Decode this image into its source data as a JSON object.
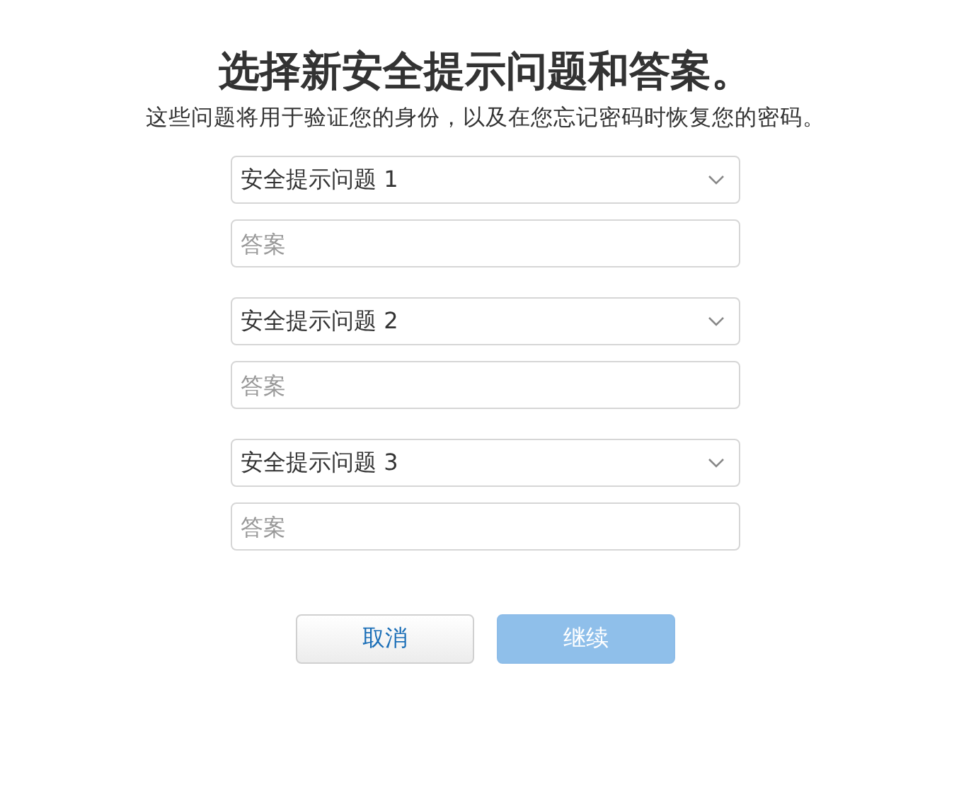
{
  "title": "选择新安全提示问题和答案。",
  "subtitle": "这些问题将用于验证您的身份，以及在您忘记密码时恢复您的密码。",
  "questions": [
    {
      "question": "安全提示问题 1",
      "answer": {
        "placeholder": "答案"
      }
    },
    {
      "question": "安全提示问题 2",
      "answer": {
        "placeholder": "答案"
      }
    },
    {
      "question": "安全提示问题 3",
      "answer": {
        "placeholder": "答案"
      }
    }
  ],
  "buttons": [
    {
      "label": "取消",
      "kind": "secondary",
      "disabled": false
    },
    {
      "label": "继续",
      "kind": "primary",
      "disabled": true
    }
  ]
}
